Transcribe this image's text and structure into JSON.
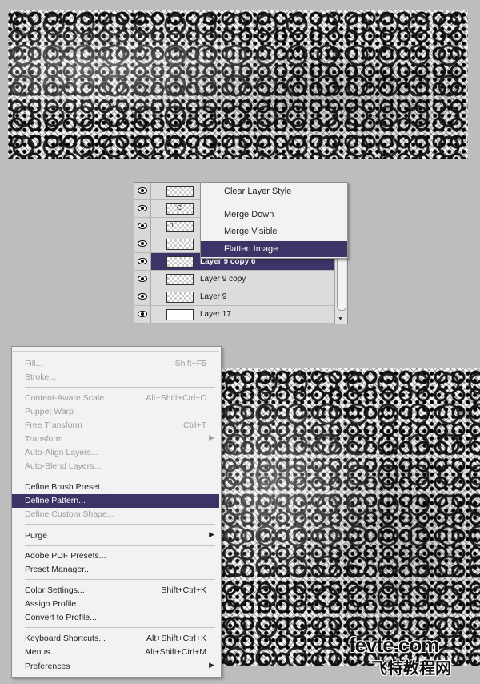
{
  "layers_panel": {
    "rows": [
      {
        "name": ""
      },
      {
        "name": ""
      },
      {
        "name": ""
      },
      {
        "name": ""
      },
      {
        "name": "Layer 9 copy 6"
      },
      {
        "name": "Layer 9 copy"
      },
      {
        "name": "Layer 9"
      },
      {
        "name": "Layer 17"
      }
    ],
    "thumb_marks": [
      "",
      "C",
      "1",
      ""
    ]
  },
  "layer_context_menu": {
    "items": [
      "Clear Layer Style",
      "Merge Down",
      "Merge Visible",
      "Flatten Image"
    ]
  },
  "edit_menu": {
    "fill": {
      "label": "Fill...",
      "shortcut": "Shift+F5"
    },
    "stroke": {
      "label": "Stroke..."
    },
    "content_aware_scale": {
      "label": "Content-Aware Scale",
      "shortcut": "Alt+Shift+Ctrl+C"
    },
    "puppet_warp": {
      "label": "Puppet Warp"
    },
    "free_transform": {
      "label": "Free Transform",
      "shortcut": "Ctrl+T"
    },
    "transform": {
      "label": "Transform"
    },
    "auto_align": {
      "label": "Auto-Align Layers..."
    },
    "auto_blend": {
      "label": "Auto-Blend Layers..."
    },
    "define_brush": {
      "label": "Define Brush Preset..."
    },
    "define_pattern": {
      "label": "Define Pattern..."
    },
    "define_shape": {
      "label": "Define Custom Shape..."
    },
    "purge": {
      "label": "Purge"
    },
    "pdf_presets": {
      "label": "Adobe PDF Presets..."
    },
    "preset_manager": {
      "label": "Preset Manager..."
    },
    "color_settings": {
      "label": "Color Settings...",
      "shortcut": "Shift+Ctrl+K"
    },
    "assign_profile": {
      "label": "Assign Profile..."
    },
    "convert_profile": {
      "label": "Convert to Profile..."
    },
    "keyboard_shortcuts": {
      "label": "Keyboard Shortcuts...",
      "shortcut": "Alt+Shift+Ctrl+K"
    },
    "menus": {
      "label": "Menus...",
      "shortcut": "Alt+Shift+Ctrl+M"
    },
    "preferences": {
      "label": "Preferences"
    }
  },
  "watermark": {
    "main": "fevte.com",
    "sub": "飞特教程网"
  },
  "colors": {
    "highlight": "#3b3567",
    "disabled": "#9c9c9c",
    "menu_bg": "#f2f2f2"
  }
}
